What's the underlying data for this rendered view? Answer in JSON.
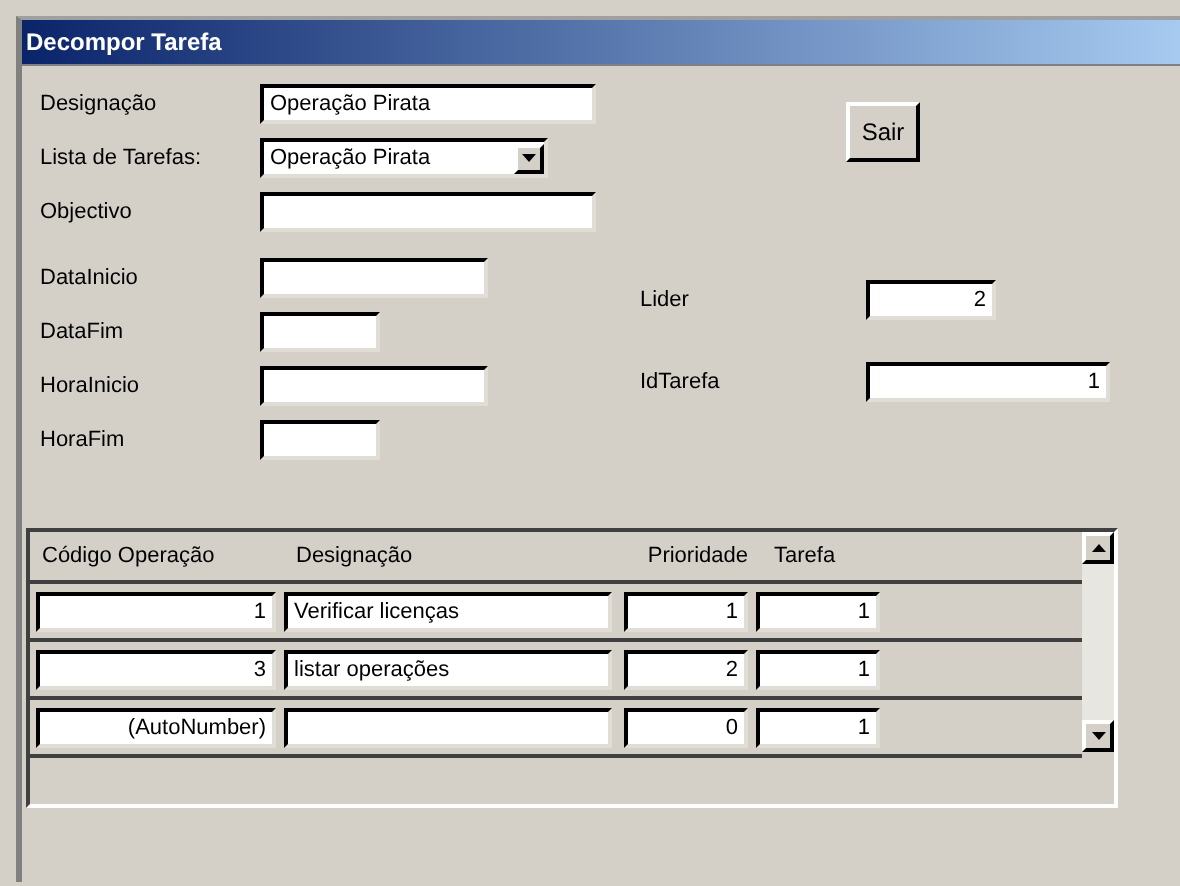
{
  "window": {
    "title": "Decompor Tarefa"
  },
  "fields": [
    {
      "label": "Designação",
      "value": "Operação Pirata",
      "kind": "text"
    },
    {
      "label": "Lista de Tarefas:",
      "value": "Operação Pirata",
      "kind": "combo"
    },
    {
      "label": "Objectivo",
      "kind": "text"
    },
    {
      "label": "DataInicio",
      "kind": "text"
    },
    {
      "label": "DataFim",
      "kind": "text"
    },
    {
      "label": "HoraInicio",
      "kind": "text"
    },
    {
      "label": "HoraFim",
      "kind": "text"
    }
  ],
  "exit_button": "Sair",
  "right_fields": [
    {
      "label": "Lider",
      "value": "2"
    },
    {
      "label": "IdTarefa",
      "value": "1"
    }
  ],
  "table": {
    "columns": [
      "Código Operação",
      "Designação",
      "Prioridade",
      "Tarefa"
    ],
    "rows": [
      {
        "codigo": "1",
        "designacao": "Verificar licenças",
        "prioridade": "1",
        "tarefa": "1"
      },
      {
        "codigo": "3",
        "designacao": "listar operações",
        "prioridade": "2",
        "tarefa": "1"
      },
      {
        "codigo": "(AutoNumber)",
        "prioridade": "0",
        "tarefa": "1"
      }
    ]
  }
}
